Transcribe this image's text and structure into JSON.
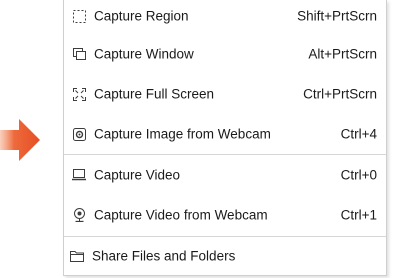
{
  "menu": {
    "items": [
      {
        "label": "Capture Region",
        "shortcut": "Shift+PrtScrn",
        "icon": "region-select-icon"
      },
      {
        "label": "Capture Window",
        "shortcut": "Alt+PrtScrn",
        "icon": "window-icon"
      },
      {
        "label": "Capture Full Screen",
        "shortcut": "Ctrl+PrtScrn",
        "icon": "fullscreen-icon"
      },
      {
        "label": "Capture Image from Webcam",
        "shortcut": "Ctrl+4",
        "icon": "webcam-image-icon"
      },
      {
        "label": "Capture Video",
        "shortcut": "Ctrl+0",
        "icon": "laptop-icon"
      },
      {
        "label": "Capture Video from Webcam",
        "shortcut": "Ctrl+1",
        "icon": "webcam-icon"
      },
      {
        "label": "Share Files and Folders",
        "shortcut": "",
        "icon": "folder-icon"
      }
    ]
  },
  "colors": {
    "arrow": "#e8542a",
    "icon": "#3c3c3c",
    "separator": "#d6d6d6"
  }
}
